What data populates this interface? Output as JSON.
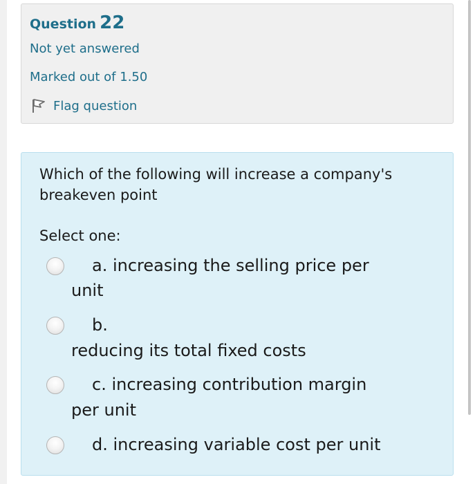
{
  "question_info": {
    "question_word": "Question",
    "question_number": "22",
    "state": "Not yet answered",
    "grade": "Marked out of 1.50",
    "flag_label": "Flag question",
    "flag_icon": "flag-icon"
  },
  "question": {
    "text": "Which of the following will increase a company's breakeven point",
    "prompt": "Select one:",
    "options": [
      {
        "line1": "a. increasing the selling price per",
        "line2": "unit",
        "selected": false
      },
      {
        "line1": "b.",
        "line2": "reducing its total fixed costs",
        "selected": false
      },
      {
        "line1": "c. increasing contribution margin",
        "line2": "per unit",
        "selected": false
      },
      {
        "line1": "d. increasing variable cost per unit",
        "line2": "",
        "selected": false
      }
    ]
  },
  "colors": {
    "info_background": "#f0f0f0",
    "content_background": "#def1f8",
    "link_text": "#1e6e8a",
    "body_text": "#1a1a1a"
  }
}
